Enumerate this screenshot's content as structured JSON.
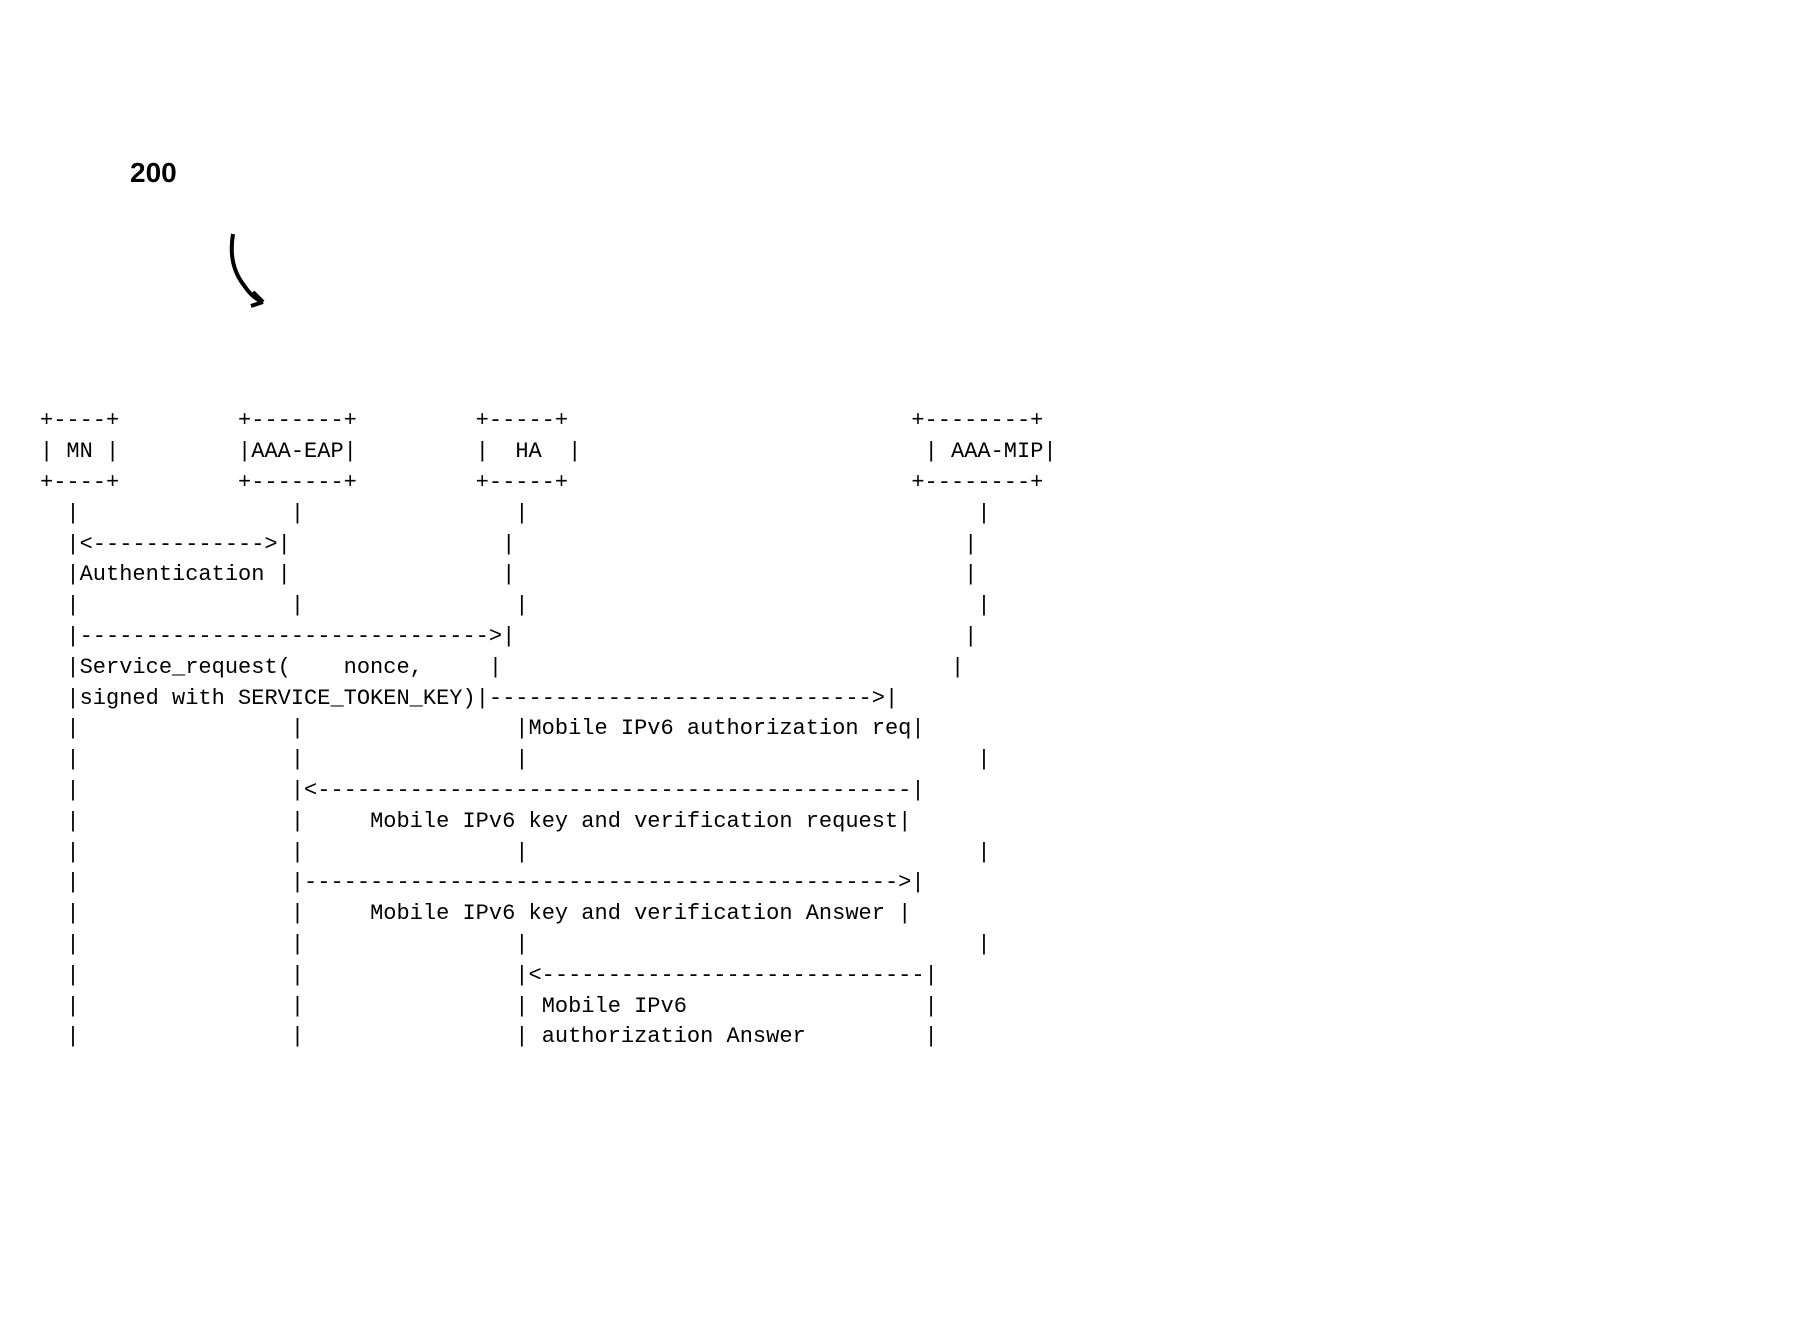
{
  "figure_number": "200",
  "actors": {
    "mn": "MN",
    "aaa_eap": "AAA-EAP",
    "ha": "HA",
    "aaa_mip": "AAA-MIP"
  },
  "messages": {
    "auth": "Authentication",
    "service_request_line1": "Service_request(    nonce,",
    "service_request_line2": "signed with SERVICE_TOKEN_KEY)",
    "mipv6_auth_req": "Mobile IPv6 authorization req",
    "mipv6_key_ver_req": "Mobile IPv6 key and verification request",
    "mipv6_key_ver_ans": "Mobile IPv6 key and verification Answer",
    "mipv6_auth_ans_line1": "Mobile IPv6",
    "mipv6_auth_ans_line2": "authorization Answer"
  }
}
